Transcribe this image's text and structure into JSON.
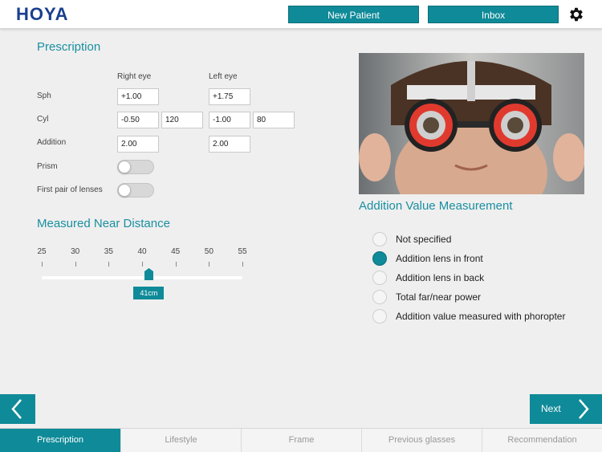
{
  "header": {
    "logo": "HOYA",
    "new_patient_label": "New Patient",
    "inbox_label": "Inbox",
    "settings_icon": "gear-icon"
  },
  "prescription": {
    "title": "Prescription",
    "col_right": "Right eye",
    "col_left": "Left eye",
    "rows": {
      "sph": {
        "label": "Sph",
        "right": "+1.00",
        "left": "+1.75"
      },
      "cyl": {
        "label": "Cyl",
        "right": "-0.50",
        "right_axis": "120",
        "left": "-1.00",
        "left_axis": "80"
      },
      "addition": {
        "label": "Addition",
        "right": "2.00",
        "left": "2.00"
      },
      "prism": {
        "label": "Prism",
        "on": false
      },
      "first_pair": {
        "label": "First pair of lenses",
        "on": false
      }
    }
  },
  "near_distance": {
    "title": "Measured Near Distance",
    "ticks": [
      "25",
      "30",
      "35",
      "40",
      "45",
      "50",
      "55"
    ],
    "min": 25,
    "max": 55,
    "value": 41,
    "value_label": "41cm"
  },
  "addition_measurement": {
    "title": "Addition Value Measurement",
    "options": [
      {
        "label": "Not specified",
        "selected": false
      },
      {
        "label": "Addition lens in front",
        "selected": true
      },
      {
        "label": "Addition lens in back",
        "selected": false
      },
      {
        "label": "Total far/near power",
        "selected": false
      },
      {
        "label": "Addition value measured with phoropter",
        "selected": false
      }
    ]
  },
  "nav": {
    "prev_icon": "chevron-left-icon",
    "next_label": "Next",
    "next_icon": "chevron-right-icon"
  },
  "tabs": [
    {
      "label": "Prescription",
      "active": true
    },
    {
      "label": "Lifestyle",
      "active": false
    },
    {
      "label": "Frame",
      "active": false
    },
    {
      "label": "Previous glasses",
      "active": false
    },
    {
      "label": "Recommendation",
      "active": false
    }
  ],
  "colors": {
    "accent": "#0f8a98",
    "title": "#1a8fa0",
    "brand": "#1b3f8f"
  }
}
